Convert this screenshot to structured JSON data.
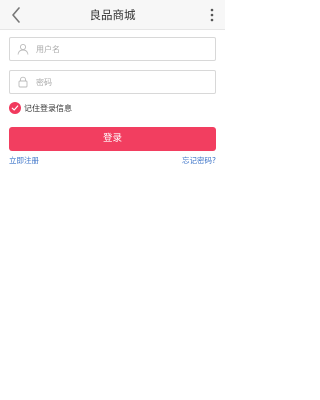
{
  "header": {
    "title": "良品商城",
    "back_icon": "chevron-left-icon",
    "more_icon": "more-vertical-icon"
  },
  "form": {
    "username_placeholder": "用户名",
    "username_value": "",
    "password_placeholder": "密码",
    "password_value": "",
    "remember_label": "记住登录信息",
    "remember_checked": true,
    "login_label": "登录"
  },
  "links": {
    "register": "立即注册",
    "forgot": "忘记密码?"
  },
  "colors": {
    "accent": "#f23e60",
    "link": "#3b73c8",
    "header_bg": "#f7f7f7"
  }
}
